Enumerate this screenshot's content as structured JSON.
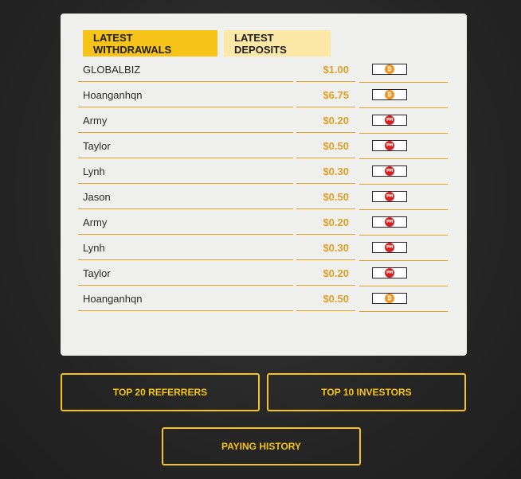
{
  "tabs": [
    {
      "label": "LATEST WITHDRAWALS",
      "active": true
    },
    {
      "label": "LATEST DEPOSITS",
      "active": false
    }
  ],
  "rows": [
    {
      "name": "GLOBALBIZ",
      "amount": "$1.00",
      "method": "bitcoin",
      "glyph": "₿"
    },
    {
      "name": "Hoanganhqn",
      "amount": "$6.75",
      "method": "bitcoin",
      "glyph": "₿"
    },
    {
      "name": "Army",
      "amount": "$0.20",
      "method": "perfect-money",
      "glyph": "PM"
    },
    {
      "name": "Taylor",
      "amount": "$0.50",
      "method": "perfect-money",
      "glyph": "PM"
    },
    {
      "name": "Lynh",
      "amount": "$0.30",
      "method": "perfect-money",
      "glyph": "PM"
    },
    {
      "name": "Jason",
      "amount": "$0.50",
      "method": "perfect-money",
      "glyph": "PM"
    },
    {
      "name": "Army",
      "amount": "$0.20",
      "method": "perfect-money",
      "glyph": "PM"
    },
    {
      "name": "Lynh",
      "amount": "$0.30",
      "method": "perfect-money",
      "glyph": "PM"
    },
    {
      "name": "Taylor",
      "amount": "$0.20",
      "method": "perfect-money",
      "glyph": "PM"
    },
    {
      "name": "Hoanganhqn",
      "amount": "$0.50",
      "method": "bitcoin",
      "glyph": "₿"
    }
  ],
  "buttons": {
    "top_referrers": "TOP 20 REFERRERS",
    "top_investors": "TOP 10 INVESTORS",
    "paying_history": "PAYING HISTORY"
  },
  "colors": {
    "accent": "#f6c418",
    "amount": "#d9a227",
    "bitcoin": "#f7931a",
    "perfect_money": "#d81e1e"
  }
}
